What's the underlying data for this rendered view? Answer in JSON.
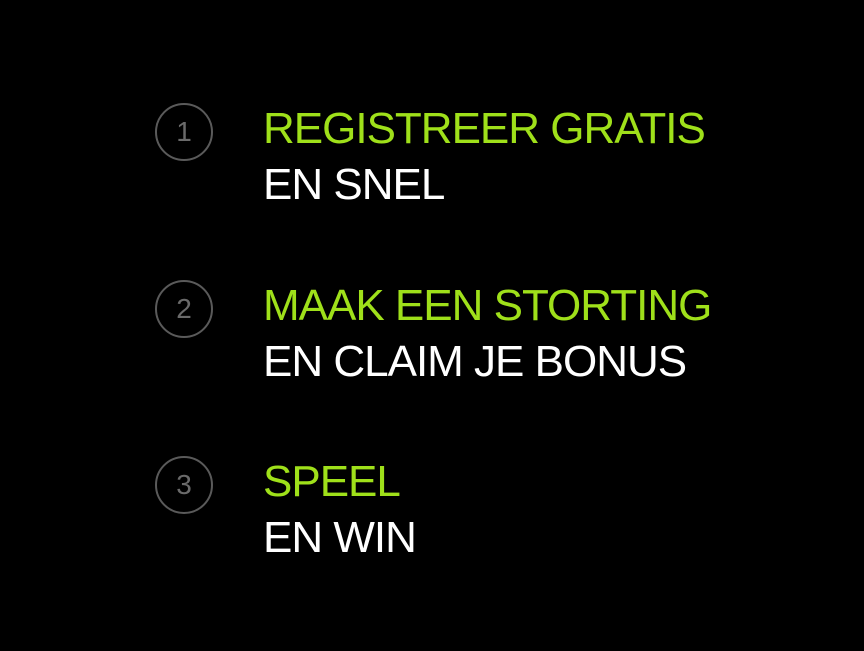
{
  "colors": {
    "background": "#000000",
    "accent": "#9fe01a",
    "text": "#ffffff",
    "number_circle": "#5a5a5a"
  },
  "steps": [
    {
      "number": "1",
      "title": "REGISTREER GRATIS",
      "subtitle": "EN SNEL"
    },
    {
      "number": "2",
      "title": "MAAK EEN STORTING",
      "subtitle": "EN CLAIM JE BONUS"
    },
    {
      "number": "3",
      "title": "SPEEL",
      "subtitle": "EN WIN"
    }
  ]
}
